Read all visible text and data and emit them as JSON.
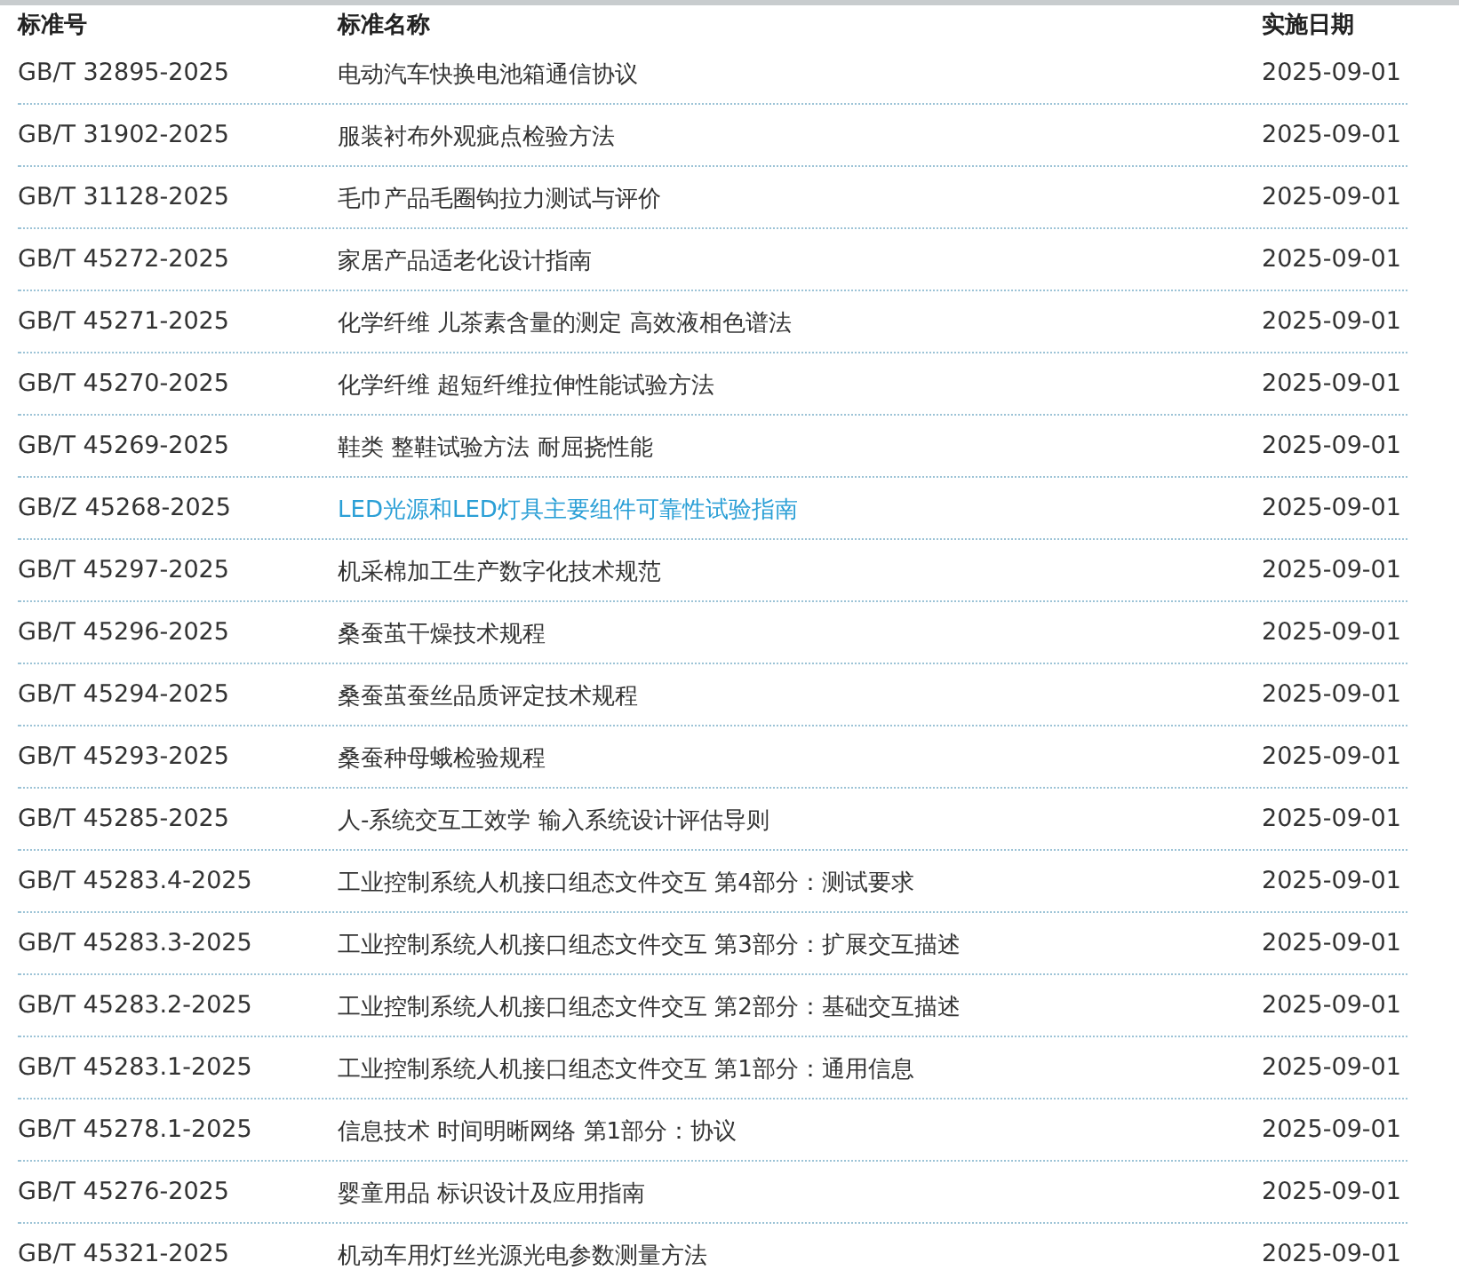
{
  "table": {
    "columns": [
      "标准号",
      "标准名称",
      "实施日期"
    ],
    "rows": [
      {
        "code": "GB/T 32895-2025",
        "name": "电动汽车快换电池箱通信协议",
        "date": "2025-09-01",
        "selected": false
      },
      {
        "code": "GB/T 31902-2025",
        "name": "服装衬布外观疵点检验方法",
        "date": "2025-09-01",
        "selected": false
      },
      {
        "code": "GB/T 31128-2025",
        "name": "毛巾产品毛圈钩拉力测试与评价",
        "date": "2025-09-01",
        "selected": false
      },
      {
        "code": "GB/T 45272-2025",
        "name": "家居产品适老化设计指南",
        "date": "2025-09-01",
        "selected": false
      },
      {
        "code": "GB/T 45271-2025",
        "name": "化学纤维 儿茶素含量的测定 高效液相色谱法",
        "date": "2025-09-01",
        "selected": false
      },
      {
        "code": "GB/T 45270-2025",
        "name": "化学纤维 超短纤维拉伸性能试验方法",
        "date": "2025-09-01",
        "selected": false
      },
      {
        "code": "GB/T 45269-2025",
        "name": "鞋类 整鞋试验方法 耐屈挠性能",
        "date": "2025-09-01",
        "selected": false
      },
      {
        "code": "GB/Z 45268-2025",
        "name": "LED光源和LED灯具主要组件可靠性试验指南",
        "date": "2025-09-01",
        "selected": true
      },
      {
        "code": "GB/T 45297-2025",
        "name": "机采棉加工生产数字化技术规范",
        "date": "2025-09-01",
        "selected": false
      },
      {
        "code": "GB/T 45296-2025",
        "name": "桑蚕茧干燥技术规程",
        "date": "2025-09-01",
        "selected": false
      },
      {
        "code": "GB/T 45294-2025",
        "name": "桑蚕茧蚕丝品质评定技术规程",
        "date": "2025-09-01",
        "selected": false
      },
      {
        "code": "GB/T 45293-2025",
        "name": "桑蚕种母蛾检验规程",
        "date": "2025-09-01",
        "selected": false
      },
      {
        "code": "GB/T 45285-2025",
        "name": "人-系统交互工效学 输入系统设计评估导则",
        "date": "2025-09-01",
        "selected": false
      },
      {
        "code": "GB/T 45283.4-2025",
        "name": "工业控制系统人机接口组态文件交互 第4部分：测试要求",
        "date": "2025-09-01",
        "selected": false
      },
      {
        "code": "GB/T 45283.3-2025",
        "name": "工业控制系统人机接口组态文件交互 第3部分：扩展交互描述",
        "date": "2025-09-01",
        "selected": false
      },
      {
        "code": "GB/T 45283.2-2025",
        "name": "工业控制系统人机接口组态文件交互 第2部分：基础交互描述",
        "date": "2025-09-01",
        "selected": false
      },
      {
        "code": "GB/T 45283.1-2025",
        "name": "工业控制系统人机接口组态文件交互 第1部分：通用信息",
        "date": "2025-09-01",
        "selected": false
      },
      {
        "code": "GB/T 45278.1-2025",
        "name": "信息技术 时间明晰网络 第1部分：协议",
        "date": "2025-09-01",
        "selected": false
      },
      {
        "code": "GB/T 45276-2025",
        "name": "婴童用品 标识设计及应用指南",
        "date": "2025-09-01",
        "selected": false
      },
      {
        "code": "GB/T 45321-2025",
        "name": "机动车用灯丝光源光电参数测量方法",
        "date": "2025-09-01",
        "selected": false
      }
    ]
  }
}
